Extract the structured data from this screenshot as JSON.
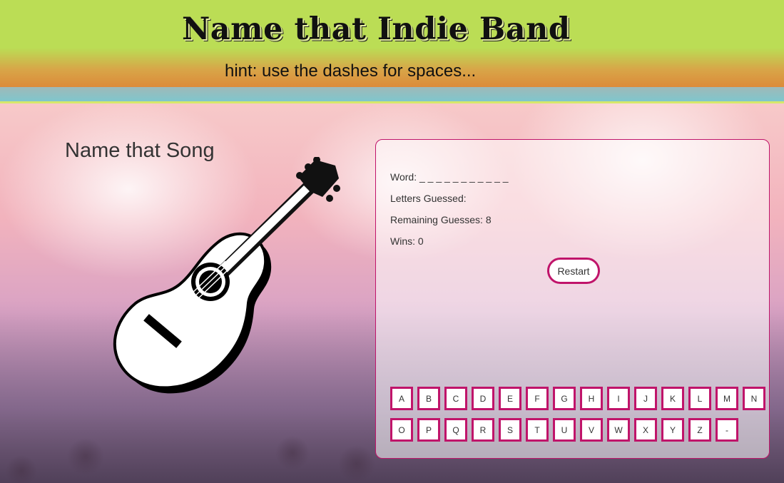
{
  "header": {
    "title": "Name that Indie Band",
    "hint": "hint: use the dashes for spaces..."
  },
  "left": {
    "song_title": "Name that Song",
    "image_icon": "guitar-icon"
  },
  "game": {
    "word_label": "Word:",
    "word_value": "_ _ _ _ _ _ _ _ _ _ _",
    "letters_label": "Letters Guessed:",
    "letters_value": "",
    "remaining_label": "Remaining Guesses:",
    "remaining_value": "8",
    "wins_label": "Wins:",
    "wins_value": "0",
    "restart_label": "Restart",
    "keys_row1": [
      "A",
      "B",
      "C",
      "D",
      "E",
      "F",
      "G",
      "H",
      "I",
      "J",
      "K",
      "L",
      "M",
      "N"
    ],
    "keys_row2": [
      "O",
      "P",
      "Q",
      "R",
      "S",
      "T",
      "U",
      "V",
      "W",
      "X",
      "Y",
      "Z",
      "-"
    ]
  },
  "colors": {
    "accent": "#c0146a",
    "header_green": "#bbdd55",
    "header_orange": "#dc8b3a",
    "stripe_teal": "#7fc6cc"
  }
}
